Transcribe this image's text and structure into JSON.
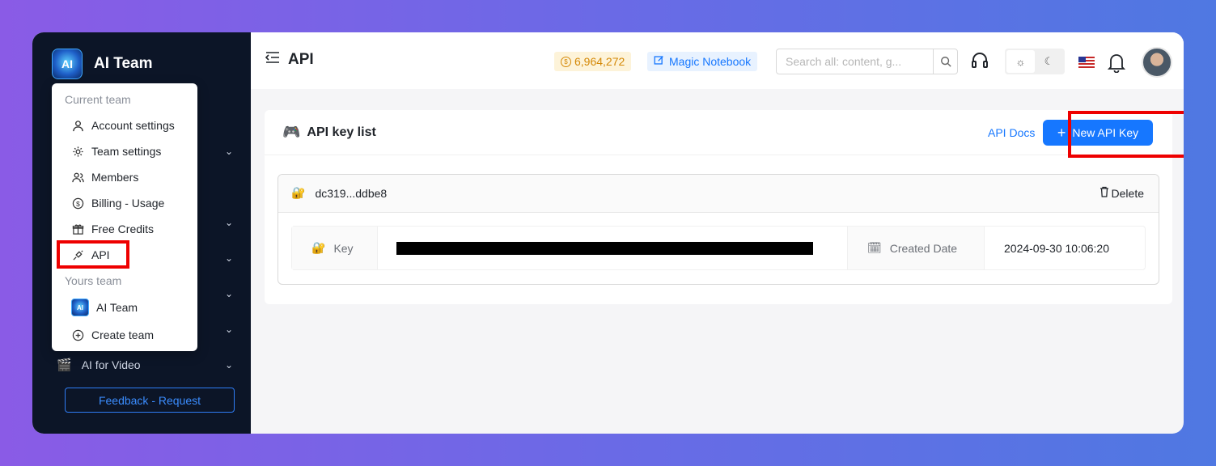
{
  "sidebar": {
    "brand": "AI Team",
    "logo_text": "AI",
    "visible_item": "AI for Video",
    "feedback_label": "Feedback - Request"
  },
  "team_menu": {
    "current_group": "Current team",
    "items": [
      {
        "label": "Account settings",
        "icon": "user-icon"
      },
      {
        "label": "Team settings",
        "icon": "gear-icon"
      },
      {
        "label": "Members",
        "icon": "members-icon"
      },
      {
        "label": "Billing - Usage",
        "icon": "dollar-icon"
      },
      {
        "label": "Free Credits",
        "icon": "gift-icon"
      },
      {
        "label": "API",
        "icon": "api-icon"
      }
    ],
    "yours_group": "Yours team",
    "team_name": "AI Team",
    "create_label": "Create team"
  },
  "header": {
    "title": "API",
    "credits": "6,964,272",
    "notebook_label": "Magic Notebook",
    "search_placeholder": "Search all: content, g..."
  },
  "card": {
    "title": "API key list",
    "docs_label": "API Docs",
    "new_key_label": "New API Key",
    "key": {
      "name": "dc319...ddbe8",
      "delete_label": "Delete",
      "key_label": "Key",
      "created_label": "Created Date",
      "created_value": "2024-09-30 10:06:20"
    }
  },
  "colors": {
    "accent": "#1677ff",
    "sidebar_bg": "#0c1527",
    "highlight": "#ee0000"
  }
}
